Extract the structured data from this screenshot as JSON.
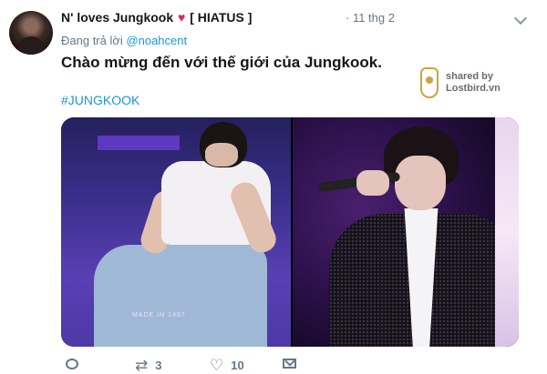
{
  "tweet": {
    "display_name": "N' loves Jungkook",
    "heart_icon": "heart-icon",
    "name_suffix": "[ HIATUS ]",
    "timestamp": "· 11 thg 2",
    "reply_prefix": "Đang trả lời",
    "reply_handle": "@noahcent",
    "text": "Chào mừng đến với thế giới của Jungkook.",
    "hashtag": "#JUNGKOOK",
    "watermark": {
      "line1": "shared by",
      "line2": "Lostbird.vn"
    },
    "media": [
      {
        "caption": "MADE IN 1997"
      },
      {
        "caption": ""
      }
    ],
    "actions": {
      "reply": {
        "icon": "reply-icon",
        "count": ""
      },
      "retweet": {
        "icon": "retweet-icon",
        "count": "3"
      },
      "like": {
        "icon": "heart-outline-icon",
        "count": "10"
      },
      "dm": {
        "icon": "envelope-icon",
        "count": ""
      }
    }
  },
  "colors": {
    "link": "#1b95e0",
    "text": "#14171a",
    "muted": "#657786",
    "heart": "#e0245e"
  }
}
